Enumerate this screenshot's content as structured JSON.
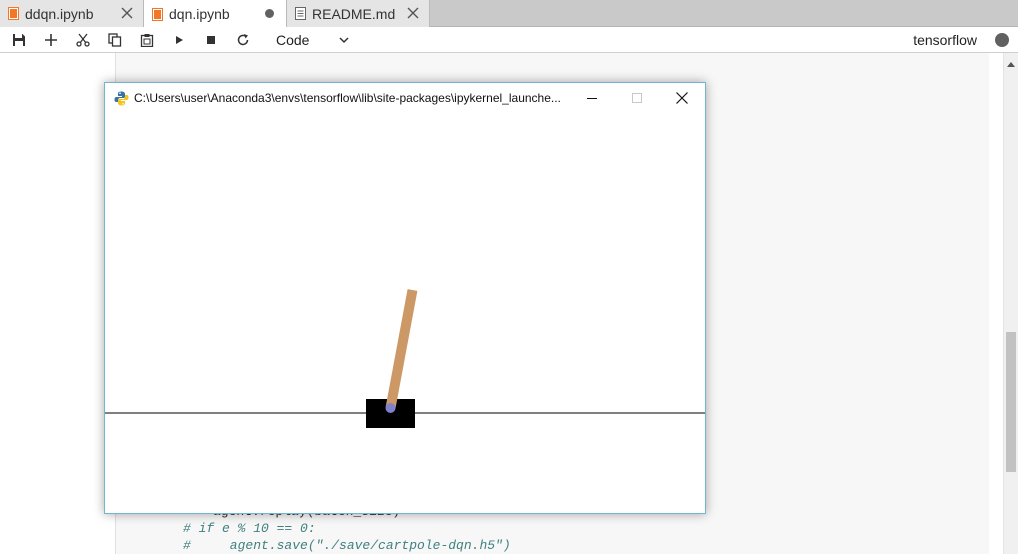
{
  "tabs": [
    {
      "label": "ddqn.ipynb",
      "icon": "notebook-icon",
      "action_icon": "close-icon"
    },
    {
      "label": "dqn.ipynb",
      "icon": "notebook-icon",
      "action_icon": "unsaved-dot-icon"
    },
    {
      "label": "README.md",
      "icon": "document-icon",
      "action_icon": "close-icon"
    }
  ],
  "toolbar": {
    "buttons": [
      "save-icon",
      "add-cell-icon",
      "cut-icon",
      "copy-icon",
      "paste-icon",
      "run-icon",
      "stop-icon",
      "restart-icon"
    ],
    "cell_type": "Code",
    "kernel": "tensorflow"
  },
  "code": {
    "line_partial": "agent.replay(batch_size)",
    "line1": "# if e % 10 == 0:",
    "line2": "#     agent.save(\"./save/cartpole-dqn.h5\")"
  },
  "window": {
    "title": "C:\\Users\\user\\Anaconda3\\envs\\tensorflow\\lib\\site-packages\\ipykernel_launche...",
    "controls": [
      "minimize-icon",
      "maximize-icon",
      "close-icon"
    ]
  },
  "scene": {
    "type": "cartpole",
    "colors": {
      "cart": "#000000",
      "pole": "#cc9966",
      "axle": "#8080cc",
      "track": "#000000"
    }
  },
  "colors": {
    "accent_orange": "#f37726",
    "tab_bar": "#c9c9c9"
  }
}
